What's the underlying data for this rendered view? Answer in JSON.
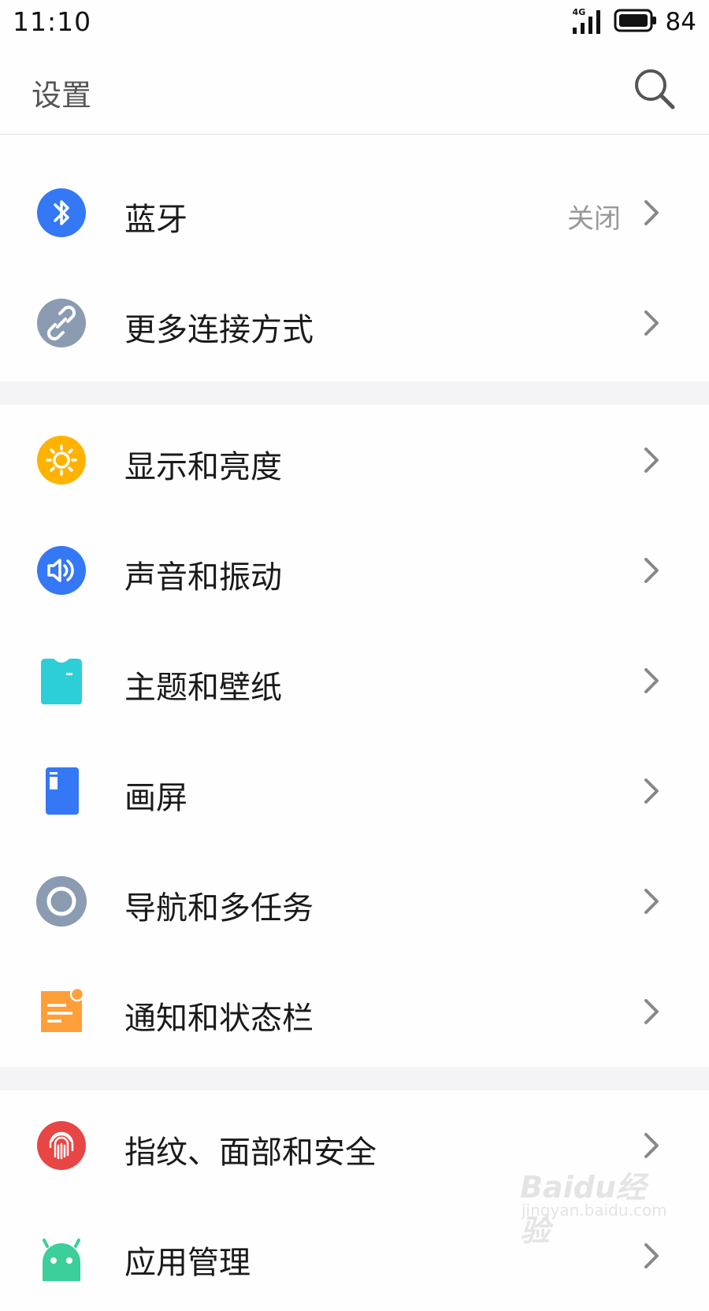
{
  "status": {
    "time": "11:10",
    "network": "4G",
    "battery": "84"
  },
  "header": {
    "title": "设置"
  },
  "groups": [
    {
      "items": [
        {
          "label": "蓝牙",
          "value": "关闭",
          "icon": "bluetooth-icon",
          "color": "#3478f6"
        },
        {
          "label": "更多连接方式",
          "icon": "link-icon",
          "color": "#8a9bb2"
        }
      ]
    },
    {
      "items": [
        {
          "label": "显示和亮度",
          "icon": "sun-icon",
          "color": "#ffb300"
        },
        {
          "label": "声音和振动",
          "icon": "speaker-icon",
          "color": "#3478f6"
        },
        {
          "label": "主题和壁纸",
          "icon": "theme-shirt-icon",
          "color": "#2ccfd8"
        },
        {
          "label": "画屏",
          "icon": "screen-icon",
          "color": "#3478f6"
        },
        {
          "label": "导航和多任务",
          "icon": "navigation-icon",
          "color": "#8a9bb2"
        },
        {
          "label": "通知和状态栏",
          "icon": "notification-icon",
          "color": "#ff9f3a"
        }
      ]
    },
    {
      "items": [
        {
          "label": "指纹、面部和安全",
          "icon": "fingerprint-icon",
          "color": "#e84545"
        },
        {
          "label": "应用管理",
          "icon": "android-icon",
          "color": "#3ccf9a"
        }
      ]
    }
  ],
  "watermark": {
    "main": "Baidu经验",
    "sub": "jingyan.baidu.com"
  }
}
